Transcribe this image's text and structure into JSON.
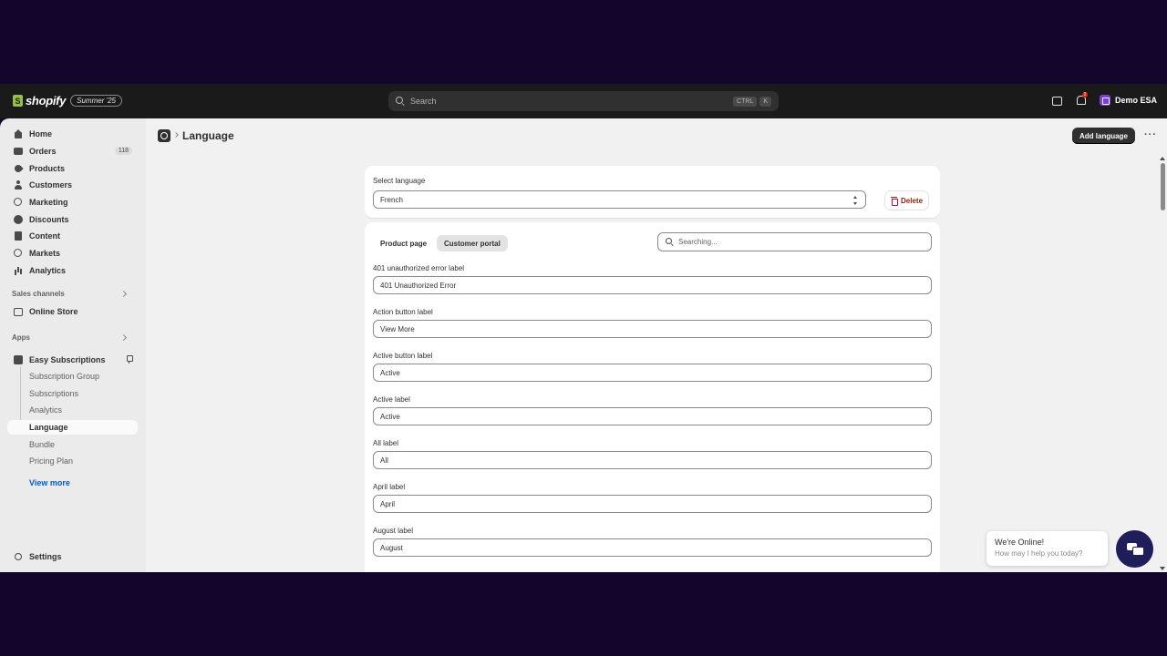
{
  "topbar": {
    "brand": "shopify",
    "edition_badge": "Summer '25",
    "search_placeholder": "Search",
    "shortcut_keys": [
      "CTRL",
      "K"
    ],
    "notification_count": "2",
    "store_name": "Demo ESA"
  },
  "sidebar": {
    "main_items": [
      {
        "label": "Home",
        "icon": "home-icon"
      },
      {
        "label": "Orders",
        "icon": "orders-icon",
        "count": "118"
      },
      {
        "label": "Products",
        "icon": "tag-icon"
      },
      {
        "label": "Customers",
        "icon": "person-icon"
      },
      {
        "label": "Marketing",
        "icon": "target-icon"
      },
      {
        "label": "Discounts",
        "icon": "discount-icon"
      },
      {
        "label": "Content",
        "icon": "content-icon"
      },
      {
        "label": "Markets",
        "icon": "globe-icon"
      },
      {
        "label": "Analytics",
        "icon": "bar-chart-icon"
      }
    ],
    "sales_channels_label": "Sales channels",
    "online_store_label": "Online Store",
    "apps_label": "Apps",
    "app_name": "Easy Subscriptions",
    "app_sub_items": [
      {
        "label": "Subscription Group"
      },
      {
        "label": "Subscriptions"
      },
      {
        "label": "Analytics"
      },
      {
        "label": "Language",
        "active": true
      },
      {
        "label": "Bundle"
      },
      {
        "label": "Pricing Plan"
      }
    ],
    "view_more_label": "View more",
    "settings_label": "Settings"
  },
  "page": {
    "title": "Language",
    "add_language_label": "Add language",
    "more_label": "···"
  },
  "language_card": {
    "select_label": "Select language",
    "selected_value": "French",
    "delete_label": "Delete"
  },
  "labels_card": {
    "tabs": [
      {
        "label": "Product page",
        "selected": false
      },
      {
        "label": "Customer portal",
        "selected": true
      }
    ],
    "search_placeholder": "Searching...",
    "fields": [
      {
        "label": "401 unauthorized error label",
        "value": "401 Unauthorized Error"
      },
      {
        "label": "Action button label",
        "value": "View More"
      },
      {
        "label": "Active button label",
        "value": "Active"
      },
      {
        "label": "Active label",
        "value": "Active"
      },
      {
        "label": "All label",
        "value": "All"
      },
      {
        "label": "April label",
        "value": "April"
      },
      {
        "label": "August label",
        "value": "August"
      }
    ]
  },
  "chat": {
    "title": "We're Online!",
    "subtitle": "How may I help you today?"
  },
  "colors": {
    "page_background": "#13052b",
    "topbar": "#1a1a1a",
    "primary_button": "#303030",
    "link": "#005bd3",
    "destructive": "#8e1f0b",
    "chat_launcher": "#1f1d5a"
  }
}
